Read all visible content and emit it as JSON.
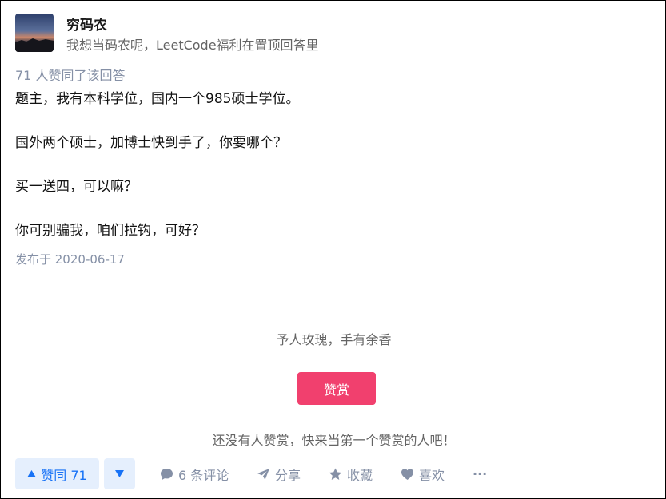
{
  "author": {
    "name": "穷码农",
    "bio": "我想当码农呢，LeetCode福利在置顶回答里"
  },
  "answer": {
    "upvote_summary": "71 人赞同了该回答",
    "paragraphs": [
      "题主，我有本科学位，国内一个985硕士学位。",
      "国外两个硕士，加博士快到手了，你要哪个？",
      "买一送四，可以嘛？",
      "你可别骗我，咱们拉钩，可好？"
    ],
    "published": "发布于 2020-06-17"
  },
  "reward": {
    "slogan": "予人玫瑰，手有余香",
    "button_label": "赞赏",
    "hint": "还没有人赞赏，快来当第一个赞赏的人吧！"
  },
  "actions": {
    "upvote_label": "赞同 71",
    "comments_label": "6 条评论",
    "share_label": "分享",
    "favorite_label": "收藏",
    "like_label": "喜欢",
    "more_label": "···"
  },
  "colors": {
    "accent": "#1772f6",
    "reward": "#f1406e",
    "meta": "#8590a6"
  }
}
